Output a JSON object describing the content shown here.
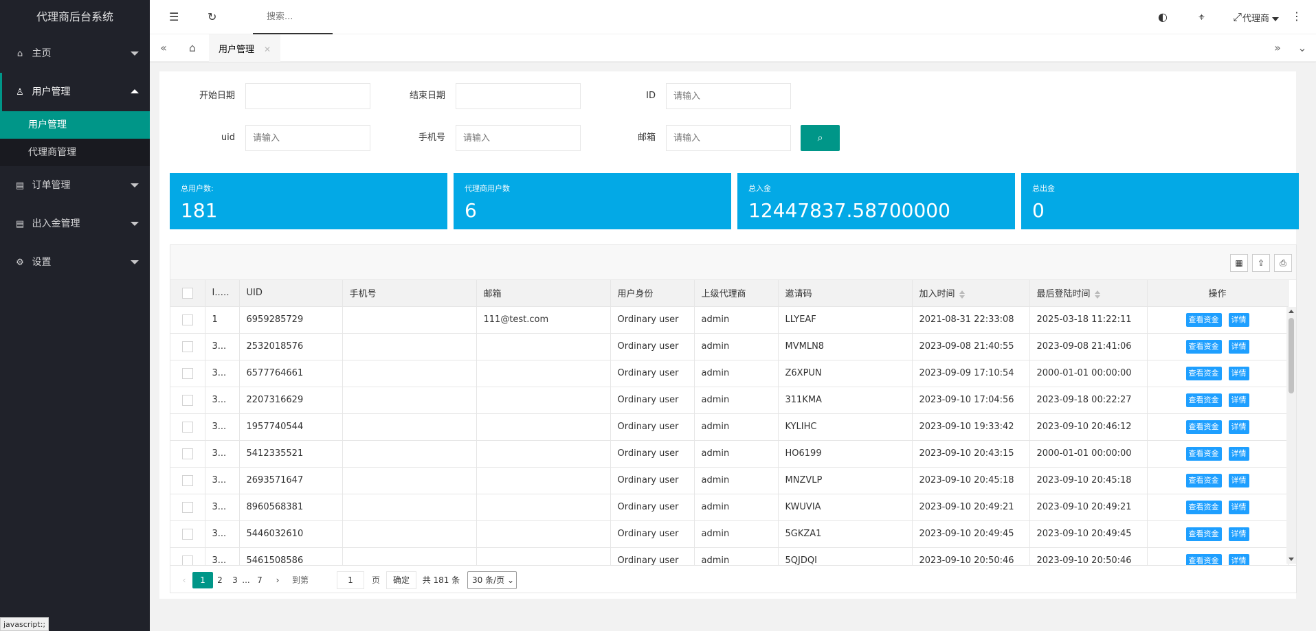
{
  "app": {
    "title": "代理商后台系统"
  },
  "sidebar": {
    "items": [
      {
        "label": "主页",
        "icon": "home-icon"
      },
      {
        "label": "用户管理",
        "icon": "user-icon"
      },
      {
        "label": "订单管理",
        "icon": "list-icon"
      },
      {
        "label": "出入金管理",
        "icon": "list-icon"
      },
      {
        "label": "设置",
        "icon": "gear-icon"
      }
    ],
    "submenu": [
      {
        "label": "用户管理"
      },
      {
        "label": "代理商管理"
      }
    ]
  },
  "header": {
    "search_placeholder": "搜索...",
    "user_label": "代理商"
  },
  "tabs": [
    {
      "label": "用户管理"
    }
  ],
  "filters": {
    "start_date": "开始日期",
    "end_date": "结束日期",
    "id": "ID",
    "uid": "uid",
    "phone": "手机号",
    "email": "邮箱",
    "placeholder": "请输入"
  },
  "stats": [
    {
      "label": "总用户数:",
      "value": "181"
    },
    {
      "label": "代理商用户数",
      "value": "6"
    },
    {
      "label": "总入金",
      "value": "12447837.58700000"
    },
    {
      "label": "总出金",
      "value": "0"
    }
  ],
  "table": {
    "columns": [
      "I...",
      "UID",
      "手机号",
      "邮箱",
      "用户身份",
      "上级代理商",
      "邀请码",
      "加入时间",
      "最后登陆时间",
      "操作"
    ],
    "action_funds": "查看资金",
    "action_detail": "详情",
    "rows": [
      {
        "id": "1",
        "uid": "6959285729",
        "phone": "",
        "email": "111@test.com",
        "role": "Ordinary user",
        "agent": "admin",
        "code": "LLYEAF",
        "joined": "2021-08-31 22:33:08",
        "last": "2025-03-18 11:22:11"
      },
      {
        "id": "3...",
        "uid": "2532018576",
        "phone": "",
        "email": "",
        "role": "Ordinary user",
        "agent": "admin",
        "code": "MVMLN8",
        "joined": "2023-09-08 21:40:55",
        "last": "2023-09-08 21:41:06"
      },
      {
        "id": "3...",
        "uid": "6577764661",
        "phone": "",
        "email": "",
        "role": "Ordinary user",
        "agent": "admin",
        "code": "Z6XPUN",
        "joined": "2023-09-09 17:10:54",
        "last": "2000-01-01 00:00:00"
      },
      {
        "id": "3...",
        "uid": "2207316629",
        "phone": "",
        "email": "",
        "role": "Ordinary user",
        "agent": "admin",
        "code": "311KMA",
        "joined": "2023-09-10 17:04:56",
        "last": "2023-09-18 00:22:27"
      },
      {
        "id": "3...",
        "uid": "1957740544",
        "phone": "",
        "email": "",
        "role": "Ordinary user",
        "agent": "admin",
        "code": "KYLIHC",
        "joined": "2023-09-10 19:33:42",
        "last": "2023-09-10 20:46:12"
      },
      {
        "id": "3...",
        "uid": "5412335521",
        "phone": "",
        "email": "",
        "role": "Ordinary user",
        "agent": "admin",
        "code": "HO6199",
        "joined": "2023-09-10 20:43:15",
        "last": "2000-01-01 00:00:00"
      },
      {
        "id": "3...",
        "uid": "2693571647",
        "phone": "",
        "email": "",
        "role": "Ordinary user",
        "agent": "admin",
        "code": "MNZVLP",
        "joined": "2023-09-10 20:45:18",
        "last": "2023-09-10 20:45:18"
      },
      {
        "id": "3...",
        "uid": "8960568381",
        "phone": "",
        "email": "",
        "role": "Ordinary user",
        "agent": "admin",
        "code": "KWUVIA",
        "joined": "2023-09-10 20:49:21",
        "last": "2023-09-10 20:49:21"
      },
      {
        "id": "3...",
        "uid": "5446032610",
        "phone": "",
        "email": "",
        "role": "Ordinary user",
        "agent": "admin",
        "code": "5GKZA1",
        "joined": "2023-09-10 20:49:45",
        "last": "2023-09-10 20:49:45"
      },
      {
        "id": "3...",
        "uid": "5461508586",
        "phone": "",
        "email": "",
        "role": "Ordinary user",
        "agent": "admin",
        "code": "5QJDQI",
        "joined": "2023-09-10 20:50:46",
        "last": "2023-09-10 20:50:46"
      }
    ]
  },
  "pager": {
    "pages": [
      "1",
      "2",
      "3",
      "...",
      "7"
    ],
    "goto_label": "到第",
    "goto_value": "1",
    "page_unit": "页",
    "confirm": "确定",
    "total": "共 181 条",
    "per_page": "30 条/页"
  },
  "statusbar": {
    "text": "javascript:;"
  },
  "colors": {
    "primary": "#009688",
    "stat": "#03a9e6",
    "button": "#1e9fff",
    "sidebar": "#20222a"
  }
}
